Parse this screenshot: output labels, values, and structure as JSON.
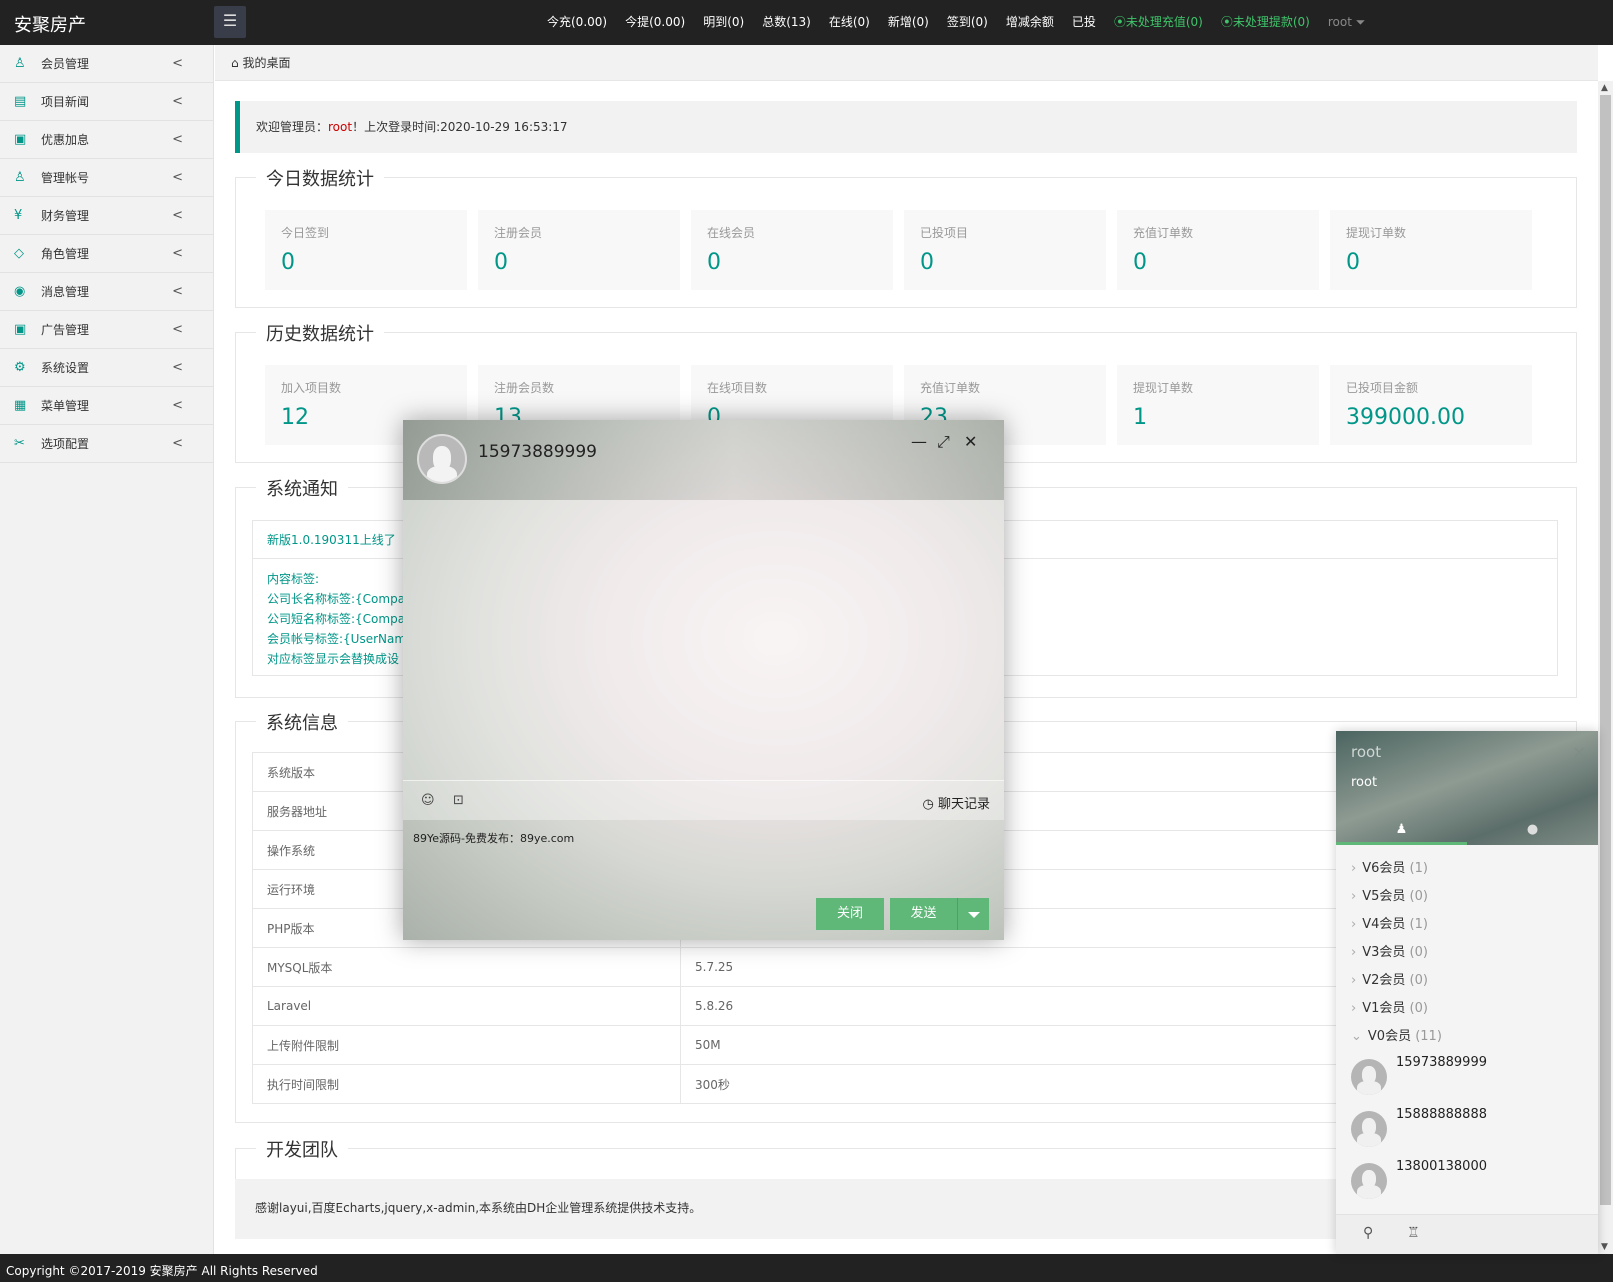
{
  "app": {
    "title": "安聚房产",
    "menu_toggle": "☰"
  },
  "topnav": [
    {
      "label": "今充(0.00)"
    },
    {
      "label": "今提(0.00)"
    },
    {
      "label": "明到(0)"
    },
    {
      "label": "总数(13)"
    },
    {
      "label": "在线(0)"
    },
    {
      "label": "新增(0)"
    },
    {
      "label": "签到(0)"
    },
    {
      "label": "增减余额"
    },
    {
      "label": "已投"
    },
    {
      "label": "⦿未处理充值(0)"
    },
    {
      "label": "⦿未处理提款(0)"
    },
    {
      "label": "root ⏷"
    }
  ],
  "sidebar": {
    "items": [
      {
        "label": "会员管理",
        "icon": "user-icon",
        "glyph": "♙"
      },
      {
        "label": "项目新闻",
        "icon": "news-icon",
        "glyph": "▤"
      },
      {
        "label": "优惠加息",
        "icon": "discount-icon",
        "glyph": "▣"
      },
      {
        "label": "管理帐号",
        "icon": "admin-icon",
        "glyph": "♙"
      },
      {
        "label": "财务管理",
        "icon": "finance-icon",
        "glyph": "¥"
      },
      {
        "label": "角色管理",
        "icon": "role-icon",
        "glyph": "◇"
      },
      {
        "label": "消息管理",
        "icon": "message-icon",
        "glyph": "◉"
      },
      {
        "label": "广告管理",
        "icon": "ad-icon",
        "glyph": "▣"
      },
      {
        "label": "系统设置",
        "icon": "settings-icon",
        "glyph": "⚙"
      },
      {
        "label": "菜单管理",
        "icon": "menu-icon",
        "glyph": "▦"
      },
      {
        "label": "选项配置",
        "icon": "config-icon",
        "glyph": "✂"
      }
    ],
    "arrow": "<"
  },
  "breadcrumb": {
    "icon": "⌂",
    "label": "我的桌面"
  },
  "welcome": {
    "prefix": "欢迎管理员：",
    "user": "root",
    "suffix": "！上次登录时间:2020-10-29 16:53:17"
  },
  "today_stats": {
    "title": "今日数据统计",
    "items": [
      {
        "label": "今日签到",
        "value": "0"
      },
      {
        "label": "注册会员",
        "value": "0"
      },
      {
        "label": "在线会员",
        "value": "0"
      },
      {
        "label": "已投项目",
        "value": "0"
      },
      {
        "label": "充值订单数",
        "value": "0"
      },
      {
        "label": "提现订单数",
        "value": "0"
      }
    ]
  },
  "history_stats": {
    "title": "历史数据统计",
    "items": [
      {
        "label": "加入项目数",
        "value": "12"
      },
      {
        "label": "注册会员数",
        "value": "13"
      },
      {
        "label": "在线项目数",
        "value": "0"
      },
      {
        "label": "充值订单数",
        "value": "23"
      },
      {
        "label": "提现订单数",
        "value": "1"
      },
      {
        "label": "已投项目金额",
        "value": "399000.00"
      }
    ]
  },
  "notice": {
    "title": "系统通知",
    "headline": "新版1.0.190311上线了",
    "lines": [
      "内容标签:",
      "公司长名称标签:{Compan",
      "公司短名称标签:{Compan",
      "会员帐号标签:{UserName",
      "对应标签显示会替换成设"
    ]
  },
  "sysinfo": {
    "title": "系统信息",
    "rows": [
      {
        "key": "系统版本",
        "value": ""
      },
      {
        "key": "服务器地址",
        "value": ""
      },
      {
        "key": "操作系统",
        "value": ""
      },
      {
        "key": "运行环境",
        "value": ""
      },
      {
        "key": "PHP版本",
        "value": ""
      },
      {
        "key": "MYSQL版本",
        "value": "5.7.25"
      },
      {
        "key": "Laravel",
        "value": "5.8.26"
      },
      {
        "key": "上传附件限制",
        "value": "50M"
      },
      {
        "key": "执行时间限制",
        "value": "300秒"
      }
    ]
  },
  "team": {
    "title": "开发团队"
  },
  "thanks": "感谢layui,百度Echarts,jquery,x-admin,本系统由DH企业管理系统提供技术支持。",
  "footer": "Copyright ©2017-2019 安聚房产 All Rights Reserved",
  "chat": {
    "name": "15973889999",
    "minimize": "—",
    "maximize": "⤢",
    "close": "✕",
    "emoji": "☺",
    "image": "⊡",
    "history_icon": "◷",
    "history": "聊天记录",
    "input_value": "89Ye源码-免费发布：89ye.com",
    "close_btn": "关闭",
    "send_btn": "发送"
  },
  "im": {
    "name": "root",
    "sign": "root",
    "close": "✕",
    "tab_friends": "♟",
    "tab_chats": "●",
    "groups": [
      {
        "name": "V6会员",
        "count": "(1)",
        "chev": "›"
      },
      {
        "name": "V5会员",
        "count": "(0)",
        "chev": "›"
      },
      {
        "name": "V4会员",
        "count": "(1)",
        "chev": "›"
      },
      {
        "name": "V3会员",
        "count": "(0)",
        "chev": "›"
      },
      {
        "name": "V2会员",
        "count": "(0)",
        "chev": "›"
      },
      {
        "name": "V1会员",
        "count": "(0)",
        "chev": "›"
      },
      {
        "name": "V0会员",
        "count": "(11)",
        "chev": "⌄"
      }
    ],
    "friends": [
      {
        "name": "15973889999"
      },
      {
        "name": "15888888888"
      },
      {
        "name": "13800138000"
      }
    ],
    "search_icon": "⚲",
    "skin_icon": "♖"
  },
  "colors": {
    "accent": "#009688",
    "button_green": "#5fb878",
    "topbar": "#222222",
    "alert_green": "#3fc46b"
  }
}
